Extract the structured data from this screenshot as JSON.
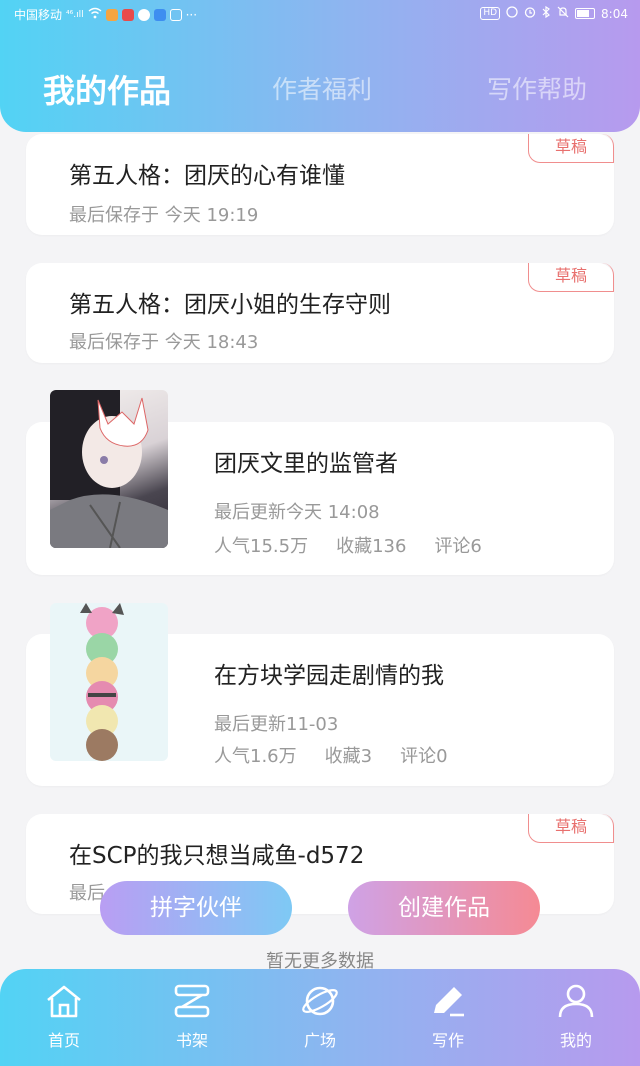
{
  "status_bar": {
    "carrier": "中国移动",
    "signal": "⁴⁶.ıll",
    "time": "8:04",
    "hd_label": "HD"
  },
  "tabs": [
    {
      "label": "我的作品",
      "active": true
    },
    {
      "label": "作者福利",
      "active": false
    },
    {
      "label": "写作帮助",
      "active": false
    }
  ],
  "drafts": [
    {
      "title": "第五人格：团厌的心有谁懂",
      "saved": "最后保存于 今天 19:19",
      "badge": "草稿"
    },
    {
      "title": "第五人格：团厌小姐的生存守则",
      "saved": "最后保存于 今天 18:43",
      "badge": "草稿"
    },
    {
      "title": "在SCP的我只想当咸鱼-d572",
      "saved": "最后",
      "badge": "草稿"
    }
  ],
  "books": [
    {
      "title": "团厌文里的监管者",
      "updated": "最后更新今天 14:08",
      "popularity": "人气15.5万",
      "favorites": "收藏136",
      "comments": "评论6"
    },
    {
      "title": "在方块学园走剧情的我",
      "updated": "最后更新11-03",
      "popularity": "人气1.6万",
      "favorites": "收藏3",
      "comments": "评论0"
    }
  ],
  "buttons": {
    "partner": "拼字伙伴",
    "create": "创建作品"
  },
  "footer_text": "暂无更多数据",
  "nav": [
    {
      "label": "首页",
      "icon": "home-icon"
    },
    {
      "label": "书架",
      "icon": "bookshelf-icon"
    },
    {
      "label": "广场",
      "icon": "planet-icon"
    },
    {
      "label": "写作",
      "icon": "pen-icon"
    },
    {
      "label": "我的",
      "icon": "user-icon"
    }
  ],
  "colors": {
    "gradient_start": "#52d3f4",
    "gradient_end": "#b79aee",
    "badge": "#e8706e",
    "create_button_end": "#f58a94"
  }
}
